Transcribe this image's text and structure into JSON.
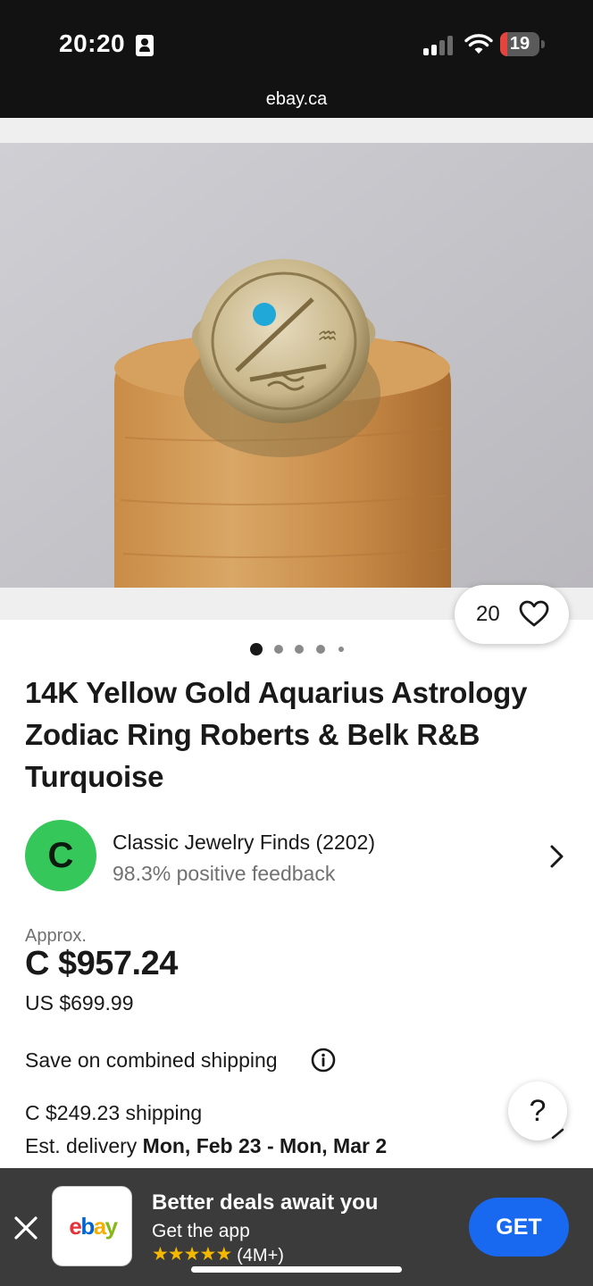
{
  "status_bar": {
    "time": "20:20",
    "battery": "19",
    "battery_level": 0.19,
    "url": "ebay.ca",
    "icons": [
      "contact-icon",
      "signal-icon",
      "wifi-icon",
      "battery-icon"
    ]
  },
  "gallery": {
    "watch_count": "20",
    "image_count": 5,
    "current_image": 1
  },
  "listing": {
    "title": "14K Yellow Gold Aquarius Astrology Zodiac Ring Roberts & Belk R&B Turquoise"
  },
  "seller": {
    "avatar_letter": "C",
    "avatar_color": "#35c759",
    "name": "Classic Jewelry Finds (2202)",
    "feedback": "98.3% positive feedback"
  },
  "price": {
    "approx_label": "Approx.",
    "converted": "C $957.24",
    "original": "US $699.99"
  },
  "shipping": {
    "combined_label": "Save on combined shipping",
    "cost": "C $249.23 shipping",
    "delivery_label": "Est. delivery",
    "delivery_dates": "Mon, Feb 23 - Mon, Mar 2",
    "help_label": "?"
  },
  "app_banner": {
    "logo": {
      "e": "e",
      "b": "b",
      "a": "a",
      "y": "y"
    },
    "title": "Better deals await you",
    "subtitle": "Get the app",
    "stars": 5,
    "rating_count": "(4M+)",
    "get_label": "GET",
    "button_color": "#1869f0"
  }
}
